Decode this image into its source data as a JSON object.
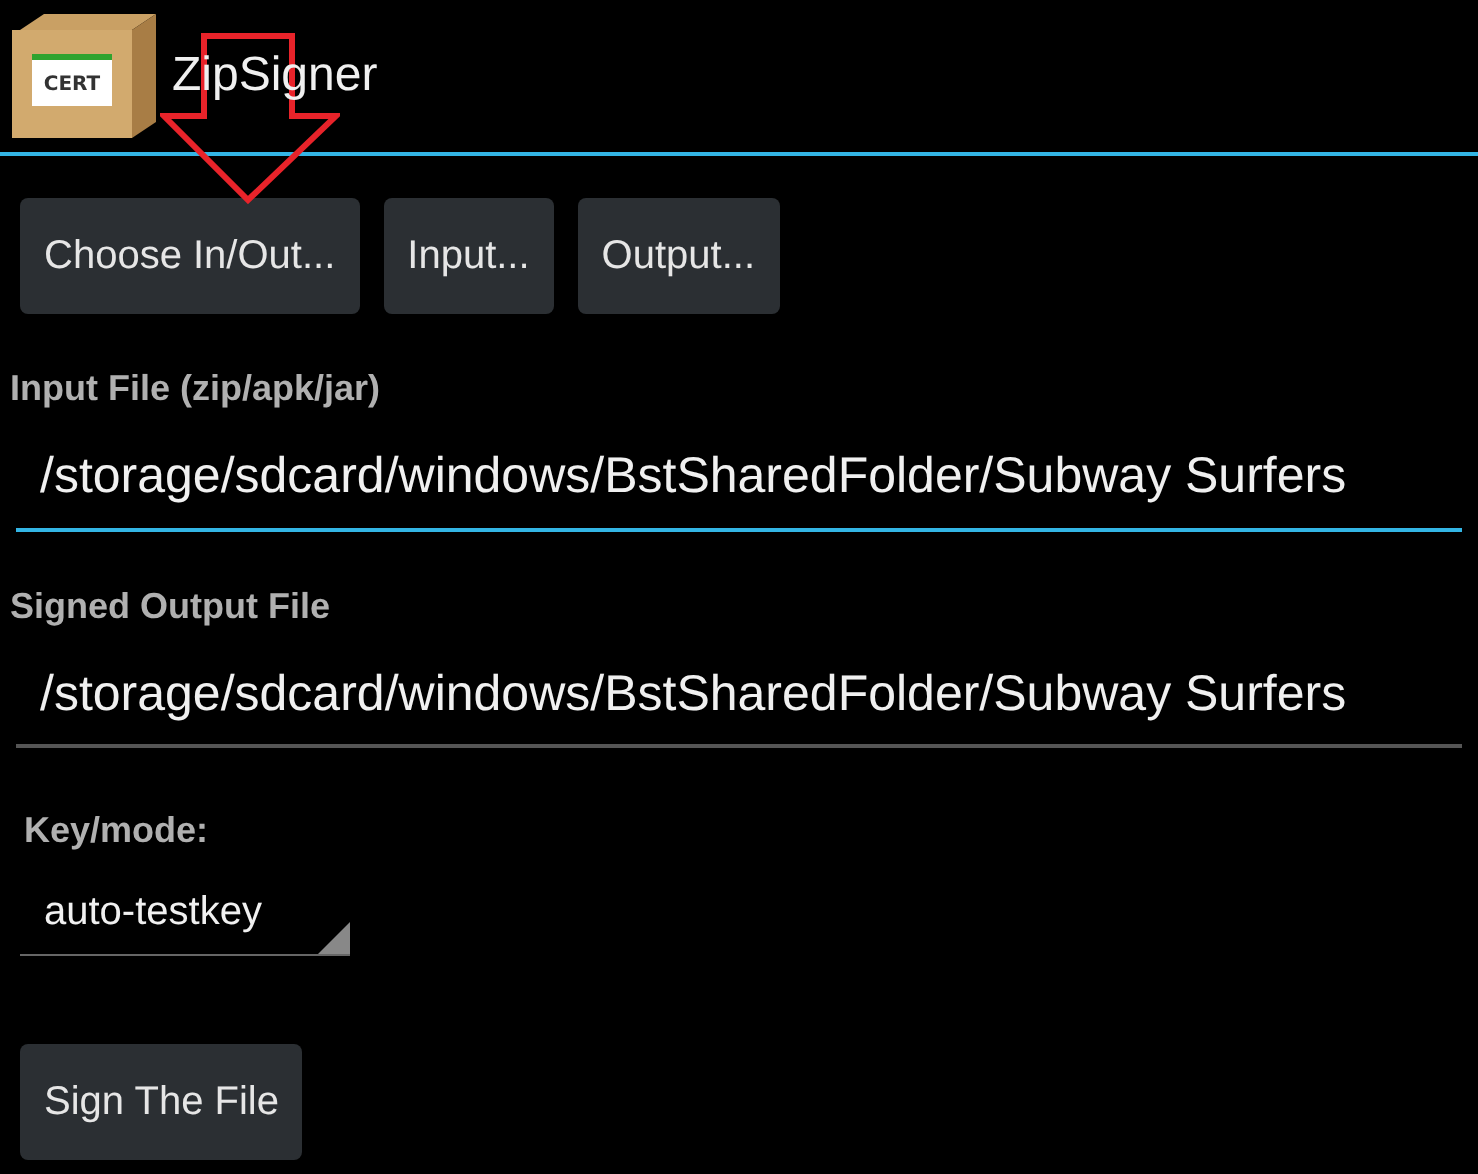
{
  "app_bar": {
    "logo_label": "CERT",
    "title": "ZipSigner"
  },
  "buttons": [
    {
      "label": "Choose In/Out..."
    },
    {
      "label": "Input..."
    },
    {
      "label": "Output..."
    }
  ],
  "fields": [
    {
      "label": "Input File (zip/apk/jar)",
      "value": "/storage/sdcard/windows/BstSharedFolder/Subway Surfers",
      "focused": true
    },
    {
      "label": "Signed Output File",
      "value": "/storage/sdcard/windows/BstSharedFolder/Subway Surfers",
      "focused": false
    }
  ],
  "key_mode": {
    "label": "Key/mode:",
    "value": "auto-testkey"
  },
  "sign_button": {
    "label": "Sign The File"
  }
}
